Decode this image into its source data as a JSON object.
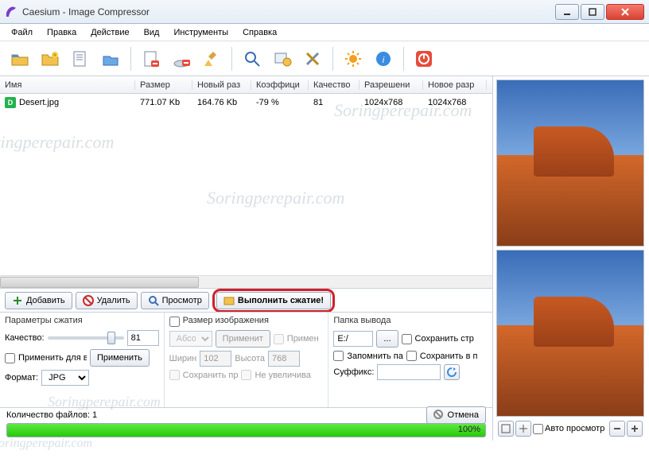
{
  "window": {
    "title": "Caesium - Image Compressor"
  },
  "menu": [
    "Файл",
    "Правка",
    "Действие",
    "Вид",
    "Инструменты",
    "Справка"
  ],
  "toolbar_icons": [
    "open-folder",
    "add-folder",
    "new-list",
    "open-list",
    "remove",
    "clear",
    "broom",
    "zoom",
    "image-settings",
    "tools",
    "sun",
    "info",
    "power"
  ],
  "columns": [
    "Имя",
    "Размер",
    "Новый раз",
    "Коэффици",
    "Качество",
    "Разрешени",
    "Новое разр"
  ],
  "rows": [
    {
      "name": "Desert.jpg",
      "size": "771.07 Kb",
      "newsize": "164.76 Kb",
      "ratio": "-79 %",
      "quality": "81",
      "res": "1024x768",
      "newres": "1024x768"
    }
  ],
  "actions": {
    "add": "Добавить",
    "delete": "Удалить",
    "preview": "Просмотр",
    "compress": "Выполнить сжатие!"
  },
  "panel_compress": {
    "title": "Параметры сжатия",
    "quality_label": "Качество:",
    "quality_value": "81",
    "apply_all": "Применить для в",
    "apply_btn": "Применить",
    "format_label": "Формат:",
    "format_value": "JPG"
  },
  "panel_resize": {
    "title": "Размер изображения",
    "abs_label": "Абсол",
    "apply_btn": "Применит",
    "apply_chk": "Примен",
    "width_label": "Ширин",
    "width_value": "102",
    "height_label": "Высота",
    "height_value": "768",
    "keep": "Сохранить пр",
    "noupscale": "Не увеличива"
  },
  "panel_output": {
    "title": "Папка вывода",
    "path": "E:/",
    "browse": "...",
    "keep_struct": "Сохранить стр",
    "remember": "Запомнить па",
    "save_in": "Сохранить в п",
    "suffix_label": "Суффикс:",
    "suffix_value": ""
  },
  "status": {
    "count_label": "Количество файлов: 1",
    "cancel": "Отмена",
    "progress_pct": "100%"
  },
  "preview_ctrl": {
    "auto": "Авто просмотр"
  },
  "watermark": "Soringperepair.com"
}
